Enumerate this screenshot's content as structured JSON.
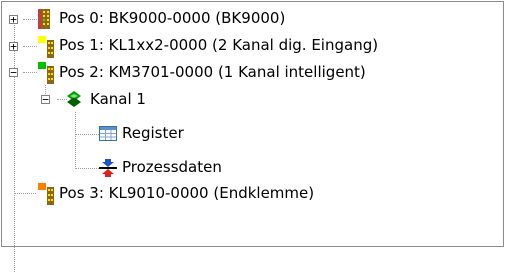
{
  "tree": {
    "pos0": {
      "label": "Pos 0: BK9000-0000  (BK9000)",
      "toggle": "+",
      "icon": "bus-coupler-icon"
    },
    "pos1": {
      "label": "Pos 1: KL1xx2-0000  (2 Kanal dig. Eingang)",
      "toggle": "+",
      "icon": "terminal-yellow-icon"
    },
    "pos2": {
      "label": "Pos 2: KM3701-0000  (1 Kanal intelligent)",
      "toggle": "−",
      "icon": "terminal-green-icon",
      "channel": {
        "label": "Kanal 1",
        "toggle": "−",
        "icon": "channel-icon",
        "children": [
          {
            "label": "Register",
            "icon": "register-table-icon"
          },
          {
            "label": "Prozessdaten",
            "icon": "process-data-icon"
          }
        ]
      }
    },
    "pos3": {
      "label": "Pos 3: KL9010-0000  (Endklemme)",
      "icon": "end-terminal-icon"
    }
  },
  "colors": {
    "yellow": "#ffff00",
    "green": "#00c000",
    "orange": "#ff8000"
  }
}
